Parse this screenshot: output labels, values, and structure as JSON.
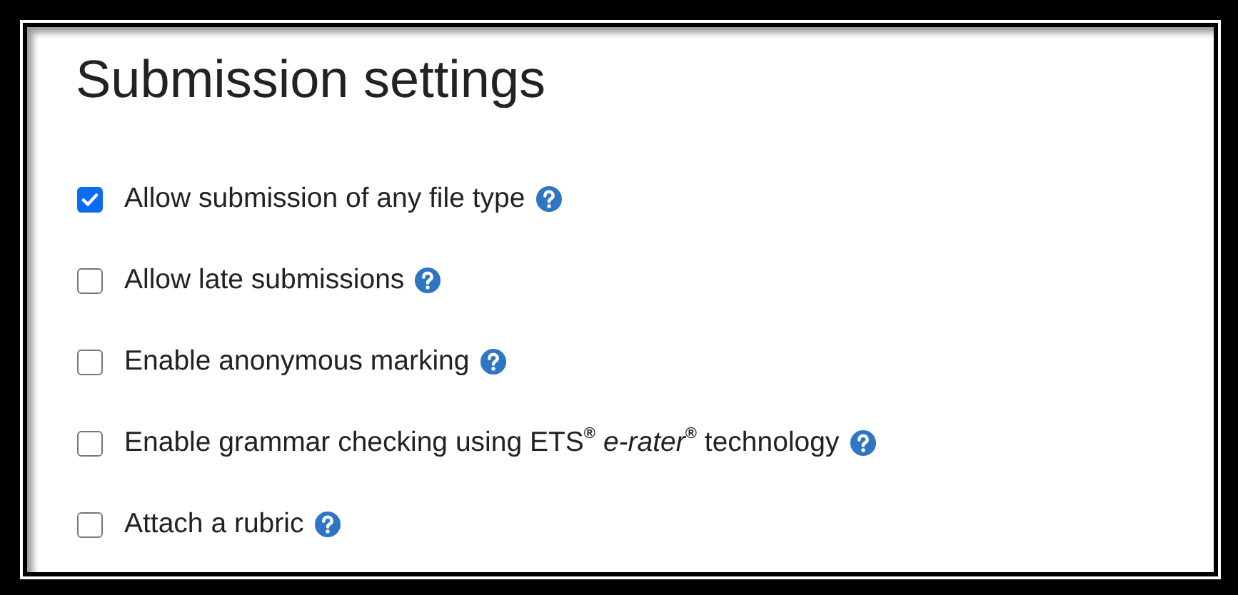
{
  "title": "Submission settings",
  "options": [
    {
      "label": "Allow submission of any file type",
      "checked": true
    },
    {
      "label": "Allow late submissions",
      "checked": false
    },
    {
      "label": "Enable anonymous marking",
      "checked": false
    },
    {
      "label": "Enable grammar checking using ETS$^{®}$ *e-rater*$^{®}$ technology",
      "checked": false
    },
    {
      "label": "Attach a rubric",
      "checked": false
    }
  ]
}
